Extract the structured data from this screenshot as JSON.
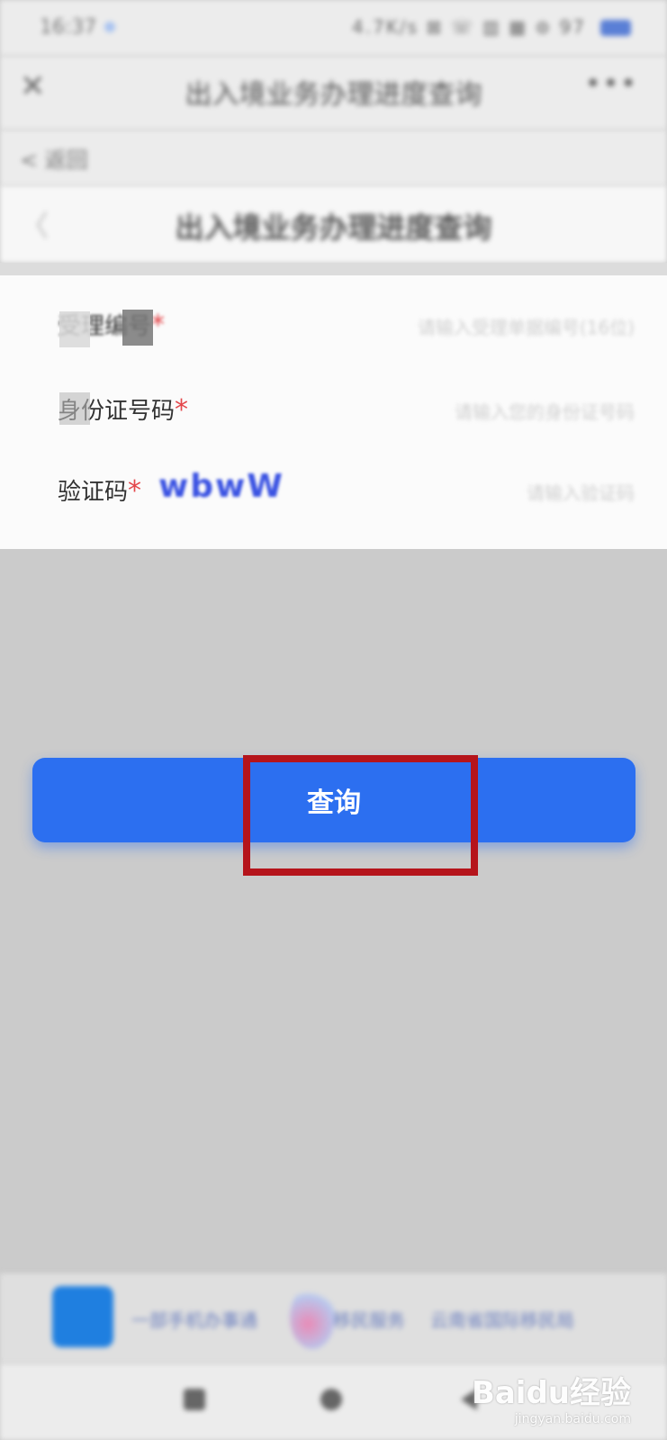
{
  "status_bar": {
    "time": "16:37",
    "icons": "4.7K/s ⊠ ☏ ▥ ▦ ⊚ 97"
  },
  "wechat_bar": {
    "title": "出入境业务办理进度查询",
    "close_icon": "close-icon",
    "more_icon": "more-icon"
  },
  "back_row": {
    "label": "< 返回"
  },
  "page_header": {
    "title": "出入境业务办理进度查询"
  },
  "form": {
    "fields": [
      {
        "label": "受理编号",
        "required_mark": "*",
        "placeholder": "请输入受理单据编号(16位)"
      },
      {
        "label": "身份证号码",
        "required_mark": "*",
        "placeholder": "请输入您的身份证号码"
      },
      {
        "label": "验证码",
        "required_mark": "*",
        "placeholder": "请输入验证码",
        "captcha": "wbwW"
      }
    ]
  },
  "actions": {
    "query_label": "查询"
  },
  "highlight": {
    "color": "#b5141b"
  },
  "footer": {
    "link1": "一部手机办事通",
    "link2": "移民服务",
    "link3": "云南省国际移民局"
  },
  "watermark": {
    "text": "Baidu经验",
    "sub": "jingyan.baidu.com"
  },
  "colors": {
    "primary": "#2c6ff0",
    "required": "#e4474b",
    "captcha": "#3b53e2"
  }
}
